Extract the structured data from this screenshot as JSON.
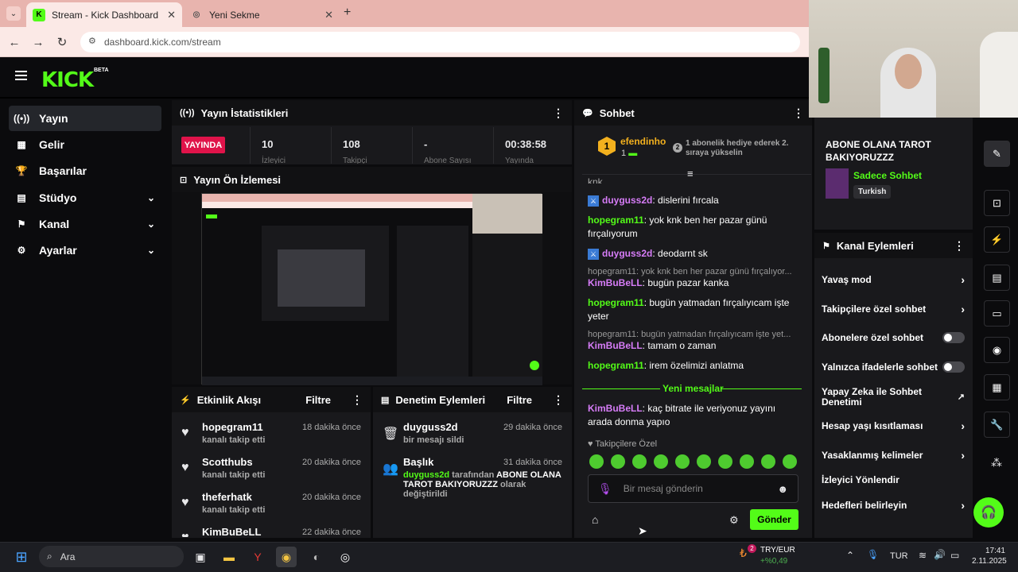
{
  "browser": {
    "tabs": [
      {
        "title": "Stream - Kick Dashboard"
      },
      {
        "title": "Yeni Sekme"
      }
    ],
    "url": "dashboard.kick.com/stream"
  },
  "app": {
    "logo": "KICK",
    "beta": "BETA",
    "sidebar": [
      {
        "label": "Yayın",
        "icon": "broadcast-icon"
      },
      {
        "label": "Gelir",
        "icon": "chart-icon"
      },
      {
        "label": "Başarılar",
        "icon": "trophy-icon"
      },
      {
        "label": "Stüdyo",
        "icon": "studio-icon"
      },
      {
        "label": "Kanal",
        "icon": "channel-icon"
      },
      {
        "label": "Ayarlar",
        "icon": "gear-icon"
      }
    ]
  },
  "stats": {
    "title": "Yayın İstatistikleri",
    "live_badge": "YAYINDA",
    "cells": [
      {
        "value": "10",
        "label": "İzleyici"
      },
      {
        "value": "108",
        "label": "Takipçi"
      },
      {
        "value": "-",
        "label": "Abone Sayısı"
      },
      {
        "value": "00:38:58",
        "label": "Yayında"
      }
    ]
  },
  "preview": {
    "title": "Yayın Ön İzlemesi"
  },
  "activity": {
    "title": "Etkinlik Akışı",
    "filter": "Filtre",
    "items": [
      {
        "name": "hopegram11",
        "desc": "kanalı takip etti",
        "time": "18 dakika önce"
      },
      {
        "name": "Scotthubs",
        "desc": "kanalı takip etti",
        "time": "20 dakika önce"
      },
      {
        "name": "theferhatk",
        "desc": "kanalı takip etti",
        "time": "20 dakika önce"
      },
      {
        "name": "KimBuBeLL",
        "desc": "",
        "time": "22 dakika önce"
      }
    ]
  },
  "moderation": {
    "title": "Denetim Eylemleri",
    "filter": "Filtre",
    "items": [
      {
        "name": "duyguss2d",
        "desc": "bir mesajı sildi",
        "time": "29 dakika önce"
      },
      {
        "name": "Başlık",
        "user": "duyguss2d",
        "mid": "tarafından",
        "bold": "ABONE OLANA TAROT BAKIYORUZZZ",
        "tail": "olarak değiştirildi",
        "time": "31 dakika önce"
      }
    ]
  },
  "chat": {
    "title": "Sohbet",
    "pinned_user": "efendinho",
    "pinned_rank": "1",
    "pinned_count": "1",
    "pinned_badge": "2",
    "pinned_text": "1 abonelik hediye ederek 2. sıraya yükselin",
    "cut_top": "knk",
    "messages": [
      {
        "user": "duyguss2d",
        "text": "dislerini fırcala",
        "color": "p",
        "badge": true
      },
      {
        "user": "hopegram11",
        "text": "yok knk ben her pazar günü fırçalıyorum",
        "color": "g"
      },
      {
        "user": "duyguss2d",
        "text": "deodarnt sk",
        "color": "p",
        "badge": true
      },
      {
        "reply": "hopegram11: yok knk ben her pazar günü fırçalıyor...",
        "user": "KimBuBeLL",
        "text": "bugün pazar kanka",
        "color": "p"
      },
      {
        "user": "hopegram11",
        "text": "bugün yatmadan fırçalıyıcam işte yeter",
        "color": "g"
      },
      {
        "reply": "hopegram11: bugün yatmadan fırçalıyıcam işte yet...",
        "user": "KimBuBeLL",
        "text": "tamam o zaman",
        "color": "p"
      },
      {
        "user": "hopegram11",
        "text": "irem özelimizi anlatma",
        "color": "g"
      }
    ],
    "new_messages": "Yeni mesajlar",
    "after_new": {
      "user": "KimBuBeLL",
      "text": "kaç bitrate ile veriyonuz yayını arada donma yapıo"
    },
    "followers_only": "Takipçilere Özel",
    "input_placeholder": "Bir mesaj gönderin",
    "send": "Gönder"
  },
  "stream_info": {
    "title": "ABONE OLANA TAROT BAKIYORUZZZ",
    "category": "Sadece Sohbet",
    "tag": "Turkish"
  },
  "channel_actions": {
    "title": "Kanal Eylemleri",
    "items": [
      {
        "label": "Yavaş mod",
        "type": "arrow"
      },
      {
        "label": "Takipçilere özel sohbet",
        "type": "arrow"
      },
      {
        "label": "Abonelere özel sohbet",
        "type": "toggle"
      },
      {
        "label": "Yalnızca ifadelerle sohbet",
        "type": "toggle"
      },
      {
        "label": "Yapay Zeka ile Sohbet Denetimi",
        "type": "external"
      },
      {
        "label": "Hesap yaşı kısıtlaması",
        "type": "arrow"
      },
      {
        "label": "Yasaklanmış kelimeler",
        "type": "arrow"
      },
      {
        "label": "İzleyici Yönlendir",
        "type": "none"
      },
      {
        "label": "Hedefleri belirleyin",
        "type": "arrow"
      }
    ]
  },
  "taskbar": {
    "search": "Ara",
    "currency": "TRY/EUR",
    "currency_change": "+%0,49",
    "currency_badge": "2",
    "lang": "TUR",
    "time": "17:41",
    "date": "2.11.2025"
  },
  "colors": {
    "accent": "#53fc18",
    "live": "#e0134a",
    "panel": "#19191c"
  }
}
